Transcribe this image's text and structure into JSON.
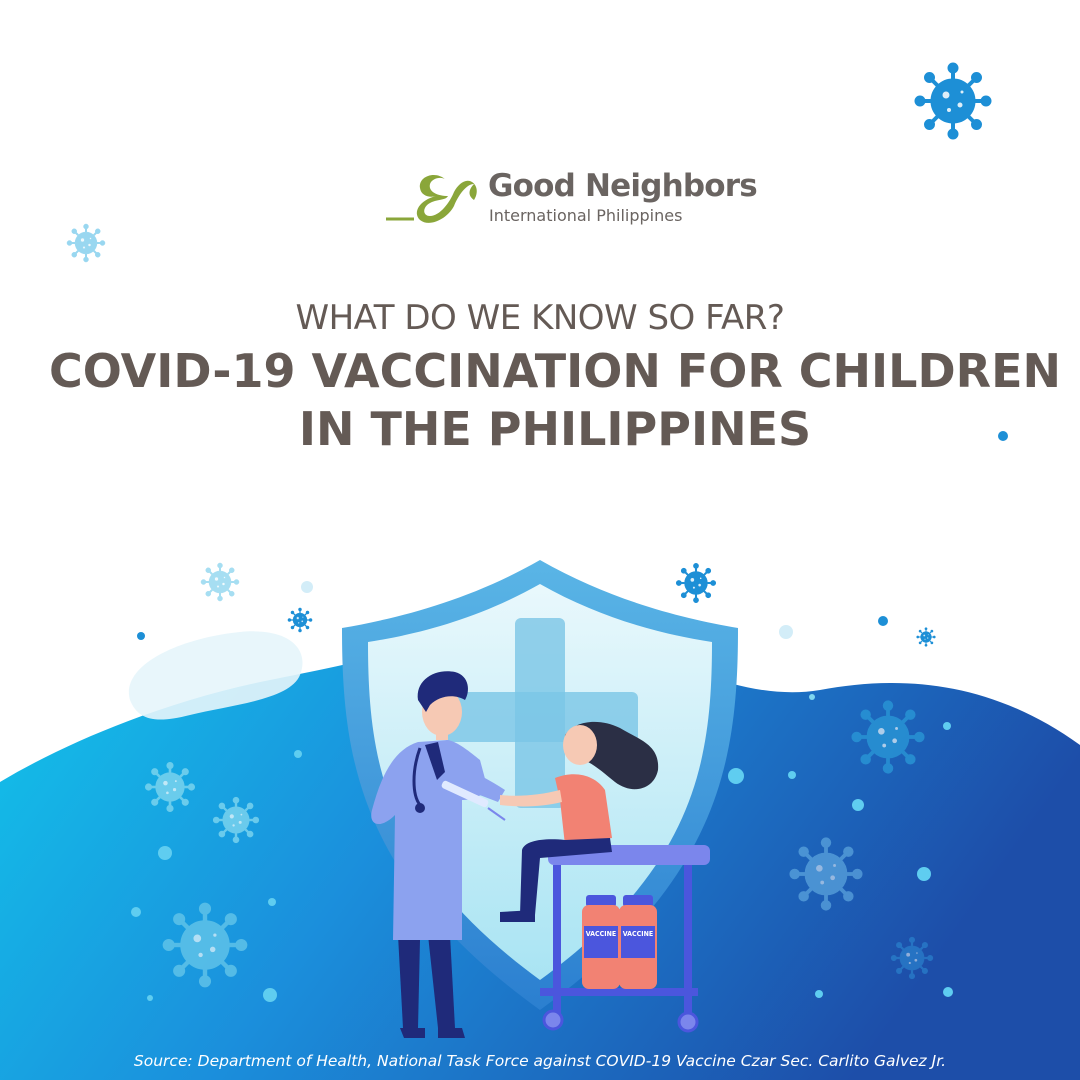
{
  "logo": {
    "name": "Good Neighbors",
    "subtitle": "International Philippines"
  },
  "heading": {
    "eyebrow": "WHAT DO WE KNOW SO FAR?",
    "title_line1": "COVID-19 VACCINATION FOR CHILDREN",
    "title_line2": "IN THE PHILIPPINES"
  },
  "illustration": {
    "vaccine_label_1": "VACCINE",
    "vaccine_label_2": "VACCINE"
  },
  "footer": {
    "source": "Source: Department of Health, National Task Force against COVID-19 Vaccine Czar Sec. Carlito Galvez Jr."
  },
  "colors": {
    "text_brown": "#645a55",
    "logo_green": "#8aa63a",
    "wave_cyan": "#14c1e6",
    "wave_blue": "#1b4fa8",
    "virus_blue": "#1b8fd6"
  }
}
